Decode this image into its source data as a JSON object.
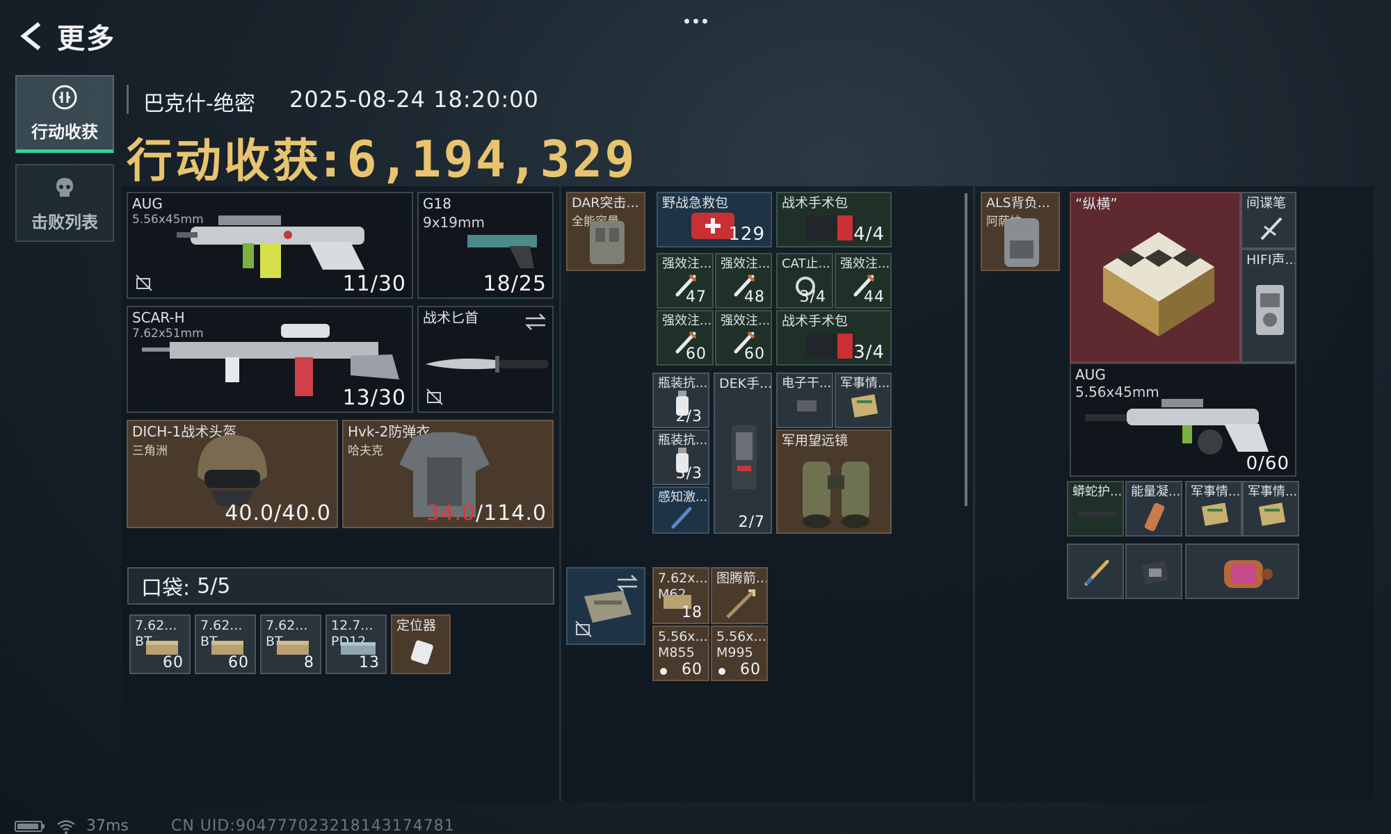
{
  "nav": {
    "back_label": "更多"
  },
  "side_tabs": [
    {
      "label": "行动收获",
      "icon": "operation-icon",
      "active": true
    },
    {
      "label": "击败列表",
      "icon": "skull-icon",
      "active": false
    }
  ],
  "header": {
    "map_name": "巴克什-绝密",
    "timestamp": "2025-08-24 18:20:00",
    "value_label": "行动收获:",
    "value": "6,194,329"
  },
  "loadout": {
    "primary": {
      "name": "AUG",
      "caliber": "5.56x45mm",
      "ammo": "11/30"
    },
    "sidearm": {
      "name": "G18",
      "caliber": "9x19mm",
      "ammo": "18/25"
    },
    "secondary": {
      "name": "SCAR-H",
      "caliber": "7.62x51mm",
      "ammo": "13/30"
    },
    "melee": {
      "name": "战术匕首"
    },
    "helmet": {
      "name": "DICH-1战术头盔",
      "origin": "三角洲",
      "durability": "40.0/40.0"
    },
    "armor": {
      "name": "Hvk-2防弹衣",
      "origin": "哈夫克",
      "durability_current": "34.0",
      "durability_max": "/114.0"
    }
  },
  "pocket": {
    "label": "口袋:",
    "count": "5/5",
    "items": [
      {
        "name": "7.62...",
        "sub": "BT",
        "count": "60"
      },
      {
        "name": "7.62...",
        "sub": "BT",
        "count": "60"
      },
      {
        "name": "7.62...",
        "sub": "BT",
        "count": "8"
      },
      {
        "name": "12.7...",
        "sub": "PD12",
        "count": "13"
      },
      {
        "name": "定位器",
        "sub": "",
        "count": ""
      }
    ]
  },
  "rig": {
    "name": "DAR突击...",
    "sub": "全能容量",
    "items": [
      {
        "name": "野战急救包",
        "count": "129"
      },
      {
        "name": "战术手术包",
        "count": "4/4"
      },
      {
        "name": "强效注...",
        "count": "47"
      },
      {
        "name": "强效注...",
        "count": "48"
      },
      {
        "name": "CAT止...",
        "count": "3/4"
      },
      {
        "name": "强效注...",
        "count": "44"
      },
      {
        "name": "强效注...",
        "count": "60"
      },
      {
        "name": "强效注...",
        "count": "60"
      },
      {
        "name": "战术手术包",
        "count": "3/4"
      },
      {
        "name": "瓶装抗...",
        "count": "2/3"
      },
      {
        "name": "瓶装抗...",
        "count": "3/3"
      },
      {
        "name": "感知激...",
        "count": ""
      },
      {
        "name": "DEK手...",
        "count": "2/7"
      },
      {
        "name": "电子干...",
        "count": ""
      },
      {
        "name": "军事情...",
        "count": ""
      },
      {
        "name": "军用望远镜",
        "count": ""
      }
    ]
  },
  "ammo_box": [
    {
      "name": "7.62x...",
      "sub": "M62",
      "count": "18"
    },
    {
      "name": "图腾箭...",
      "sub": "",
      "count": ""
    },
    {
      "name": "5.56x...",
      "sub": "M855",
      "count": "60"
    },
    {
      "name": "5.56x...",
      "sub": "M995",
      "count": "60"
    }
  ],
  "backpack": {
    "name": "ALS背负...",
    "sub": "阿萨拉",
    "items": [
      {
        "name": "“纵横”"
      },
      {
        "name": "间谍笔"
      },
      {
        "name": "HIFI声..."
      },
      {
        "name": "AUG",
        "sub": "5.56x45mm",
        "count": "0/60"
      },
      {
        "name": "蟒蛇护..."
      },
      {
        "name": "能量凝..."
      },
      {
        "name": "军事情..."
      },
      {
        "name": "军事情..."
      },
      {
        "name": ""
      },
      {
        "name": ""
      },
      {
        "name": ""
      }
    ]
  },
  "status": {
    "ping": "37ms",
    "uid": "CN UID:904777023218143174781"
  },
  "colors": {
    "accent_gold": "#e8c470",
    "active_green": "#34d399",
    "damage_red": "#e0383a"
  }
}
